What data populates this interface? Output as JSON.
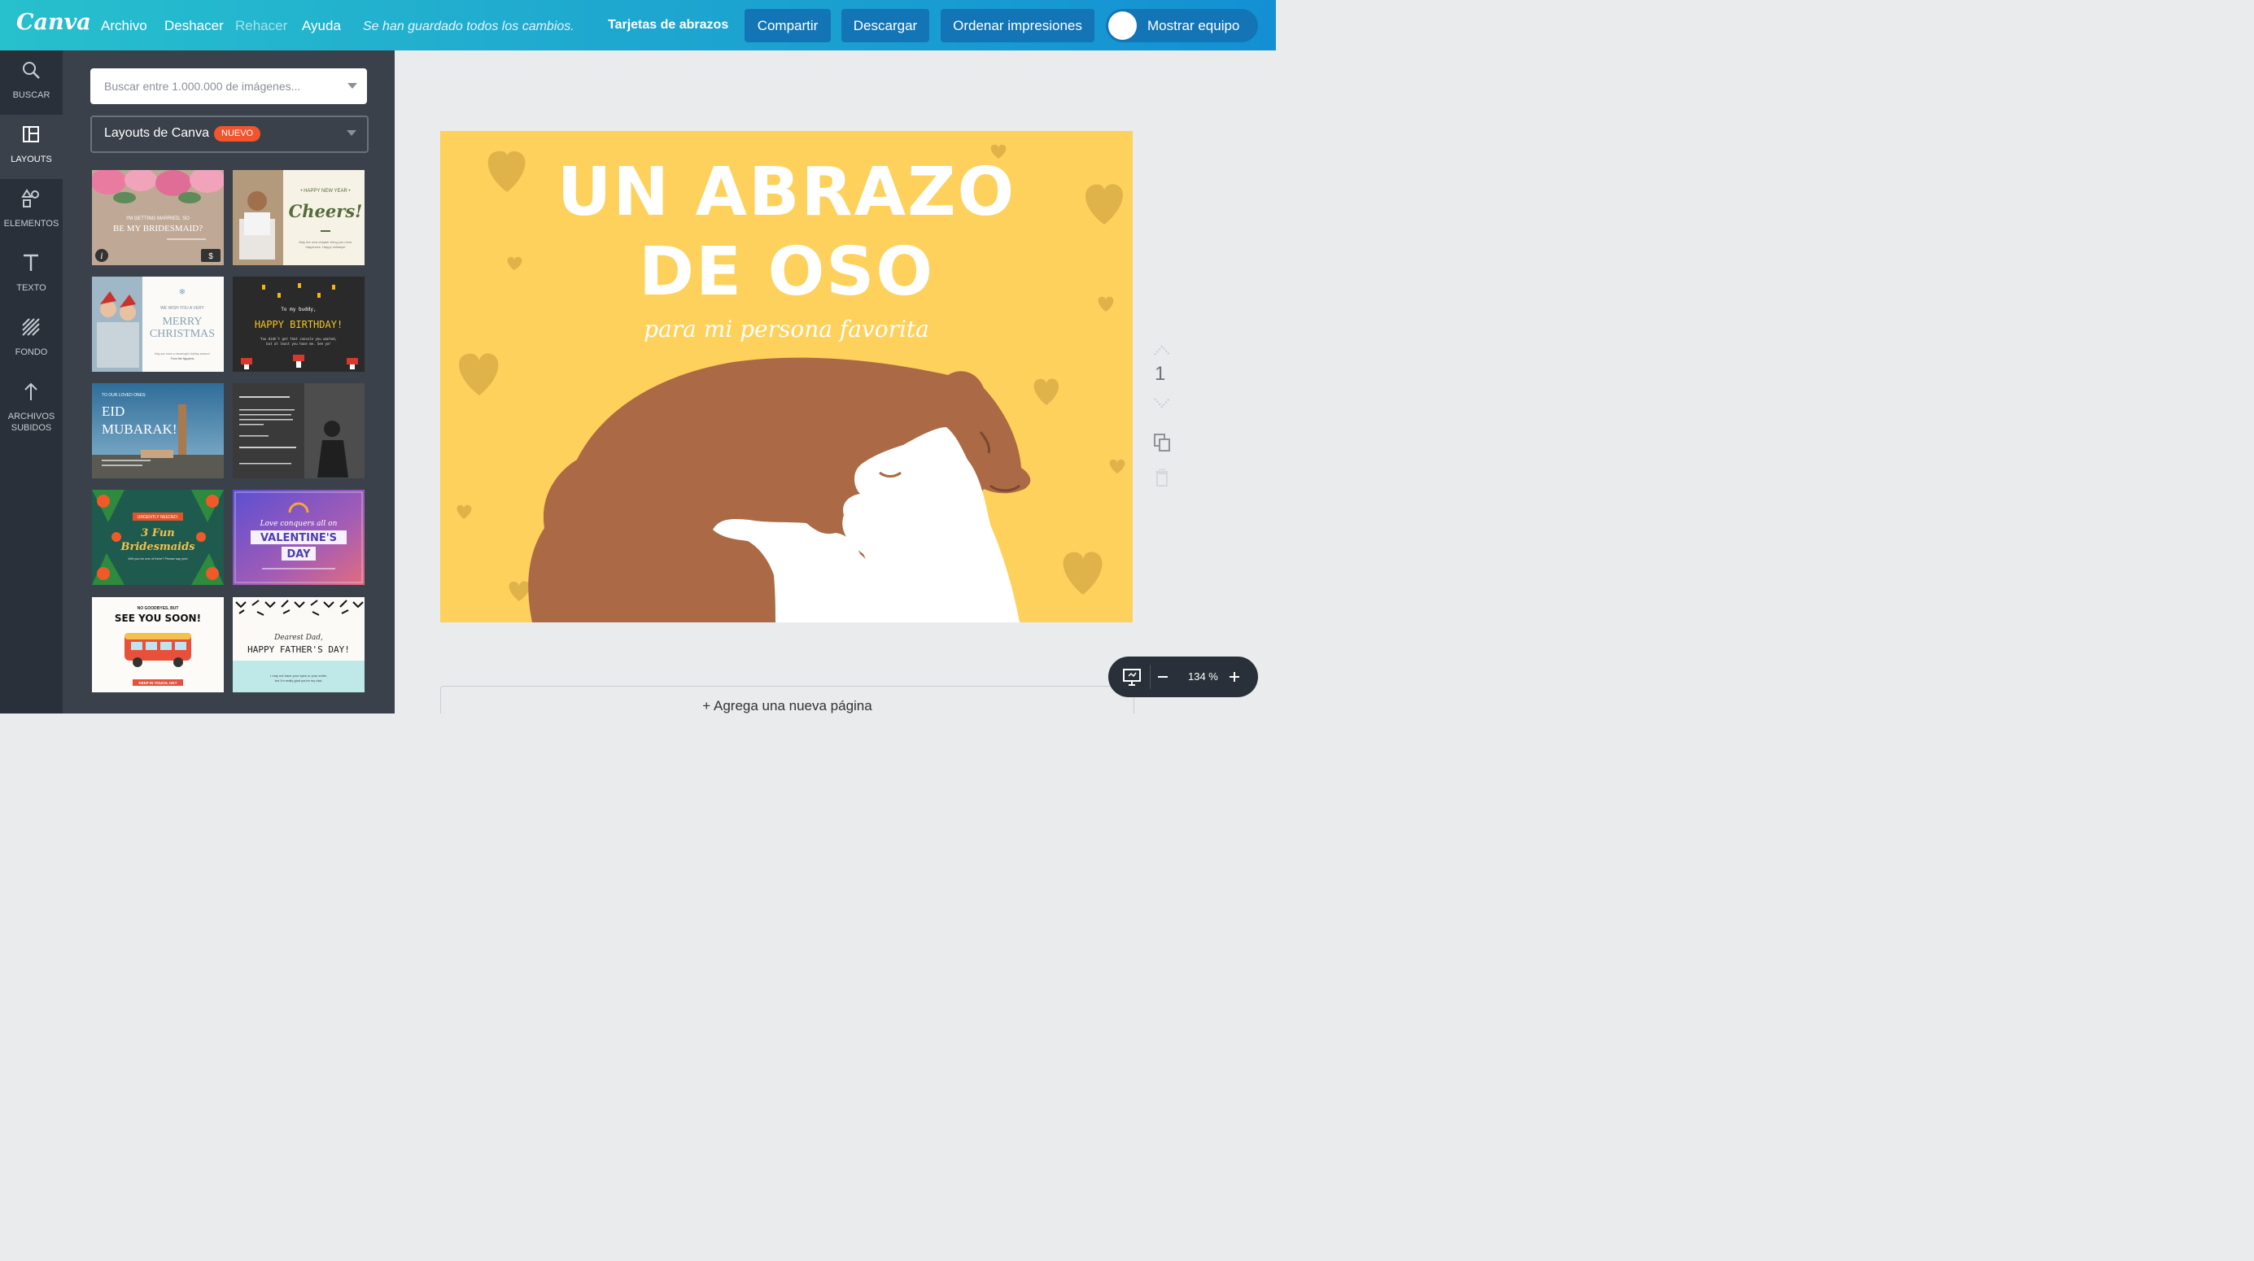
{
  "app": {
    "logo": "Canva"
  },
  "topbar": {
    "menu": [
      "Archivo",
      "Deshacer",
      "Rehacer",
      "Ayuda"
    ],
    "saved_status": "Se han guardado todos los cambios.",
    "doc_title": "Tarjetas de abrazos",
    "share": "Compartir",
    "download": "Descargar",
    "order": "Ordenar impresiones",
    "team": "Mostrar equipo"
  },
  "rail": [
    {
      "label": "BUSCAR",
      "icon": "search-icon"
    },
    {
      "label": "LAYOUTS",
      "icon": "layouts-icon"
    },
    {
      "label": "ELEMENTOS",
      "icon": "elements-icon"
    },
    {
      "label": "TEXTO",
      "icon": "text-icon"
    },
    {
      "label": "FONDO",
      "icon": "background-icon"
    },
    {
      "label": "ARCHIVOS",
      "label2": "SUBIDOS",
      "icon": "upload-icon"
    }
  ],
  "panel": {
    "search_placeholder": "Buscar entre 1.000.000 de imágenes...",
    "layouts_label": "Layouts de Canva",
    "new_badge": "NUEVO"
  },
  "templates": [
    {
      "name": "bridesmaid",
      "line1": "I'M GETTING MARRIED, SO",
      "line2": "BE MY BRIDESMAID?",
      "info": "i",
      "price": "$"
    },
    {
      "name": "new-year",
      "line1": "• HAPPY NEW YEAR •",
      "line2": "Cheers!",
      "line3": "May the new chapter bring you more",
      "line4": "happiness. Happy holidays!"
    },
    {
      "name": "christmas",
      "line1": "WE WISH YOU A VERY",
      "line2": "MERRY",
      "line3": "CHRISTMAS",
      "line4": "May you have a meaningful holiday season!",
      "line5": "From the Nguyens"
    },
    {
      "name": "birthday",
      "line1": "To my buddy,",
      "line2": "HAPPY BIRTHDAY!",
      "line3": "You didn't get that console you wanted,",
      "line4": "but at least you have me. See ya!"
    },
    {
      "name": "eid",
      "line1": "TO OUR LOVED ONES:",
      "line2": "EID",
      "line3": "MUBARAK!"
    },
    {
      "name": "sympathy"
    },
    {
      "name": "fun-bridesmaids",
      "line1": "URGENTLY NEEDED:",
      "line2": "3 Fun",
      "line3": "Bridesmaids",
      "line4": "Will you be one of them? Please say yes!"
    },
    {
      "name": "valentine",
      "line1": "Love conquers all on",
      "line2": "VALENTINE'S",
      "line3": "DAY"
    },
    {
      "name": "see-you-soon",
      "line1": "NO GOODBYES, BUT",
      "line2": "SEE YOU SOON!",
      "line3": "KEEP IN TOUCH, OK?"
    },
    {
      "name": "fathers-day",
      "line1": "Dearest Dad,",
      "line2": "HAPPY FATHER'S DAY!",
      "line3": "I may not have your eyes or your smile,",
      "line4": "but I'm really glad you're my dad."
    }
  ],
  "design": {
    "title_line1": "UN ABRAZO",
    "title_line2": "DE OSO",
    "subtitle": "para mi persona favorita",
    "background": "#fdd15c",
    "bear_color": "#ab6a45",
    "heart_color": "#e0b24a"
  },
  "page": {
    "number": "1",
    "add_page": "+ Agrega una nueva página"
  },
  "zoom": {
    "value": "134 %"
  }
}
